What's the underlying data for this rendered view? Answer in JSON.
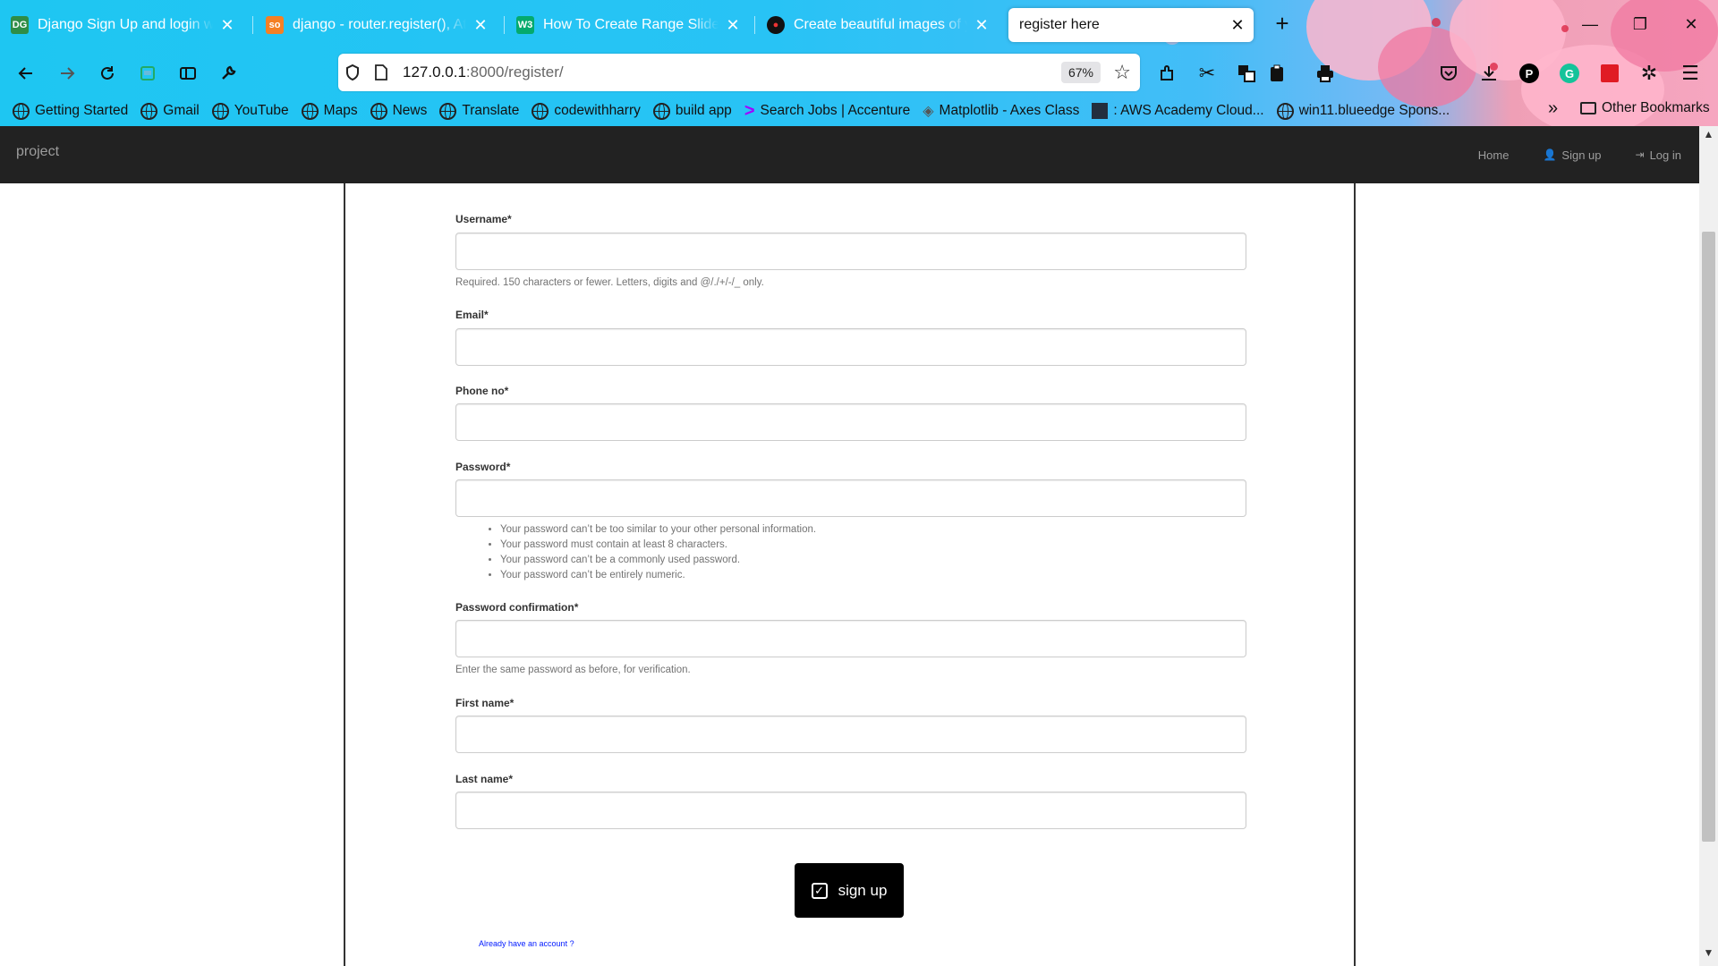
{
  "browser": {
    "tabs": [
      {
        "title": "Django Sign Up and login with",
        "favicon": "DG",
        "favicon_bg": "#2f8d46",
        "active": false
      },
      {
        "title": "django - router.register(), AttributeError",
        "favicon": "so",
        "favicon_bg": "#f48024",
        "active": false
      },
      {
        "title": "How To Create Range Sliders",
        "favicon": "W3",
        "favicon_bg": "#04aa6d",
        "active": false
      },
      {
        "title": "Create beautiful images of your code",
        "favicon": "●",
        "favicon_bg": "#111111",
        "active": false
      },
      {
        "title": "register here",
        "favicon": "",
        "favicon_bg": "",
        "active": true
      }
    ],
    "url_host": "127.0.0.1",
    "url_rest": ":8000/register/",
    "zoom": "67%",
    "bookmarks": [
      "Getting Started",
      "Gmail",
      "YouTube",
      "Maps",
      "News",
      "Translate",
      "codewithharry",
      "build app",
      "Search Jobs | Accenture",
      "Matplotlib - Axes Class",
      ": AWS Academy Cloud...",
      "win11.blueedge Spons..."
    ],
    "other_bookmarks": "Other Bookmarks"
  },
  "site": {
    "brand": "project",
    "nav": {
      "home": "Home",
      "signup": "Sign up",
      "login": "Log in"
    }
  },
  "form": {
    "username_label": "Username*",
    "username_help": "Required. 150 characters or fewer. Letters, digits and @/./+/-/_ only.",
    "email_label": "Email*",
    "phone_label": "Phone no*",
    "password_label": "Password*",
    "password_rules": [
      "Your password can’t be too similar to your other personal information.",
      "Your password must contain at least 8 characters.",
      "Your password can’t be a commonly used password.",
      "Your password can’t be entirely numeric."
    ],
    "password2_label": "Password confirmation*",
    "password2_help": "Enter the same password as before, for verification.",
    "first_name_label": "First name*",
    "last_name_label": "Last name*",
    "submit_label": "sign up",
    "login_link": "Already have an account ?"
  }
}
